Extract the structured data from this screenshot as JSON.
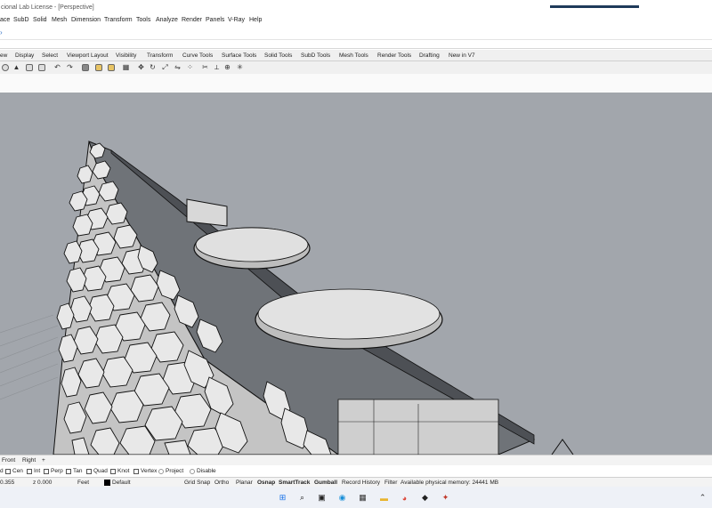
{
  "window": {
    "title": "cional Lab License - [Perspective]"
  },
  "menu": [
    "ace",
    "SubD",
    "Solid",
    "Mesh",
    "Dimension",
    "Transform",
    "Tools",
    "Analyze",
    "Render",
    "Panels",
    "V-Ray",
    "Help"
  ],
  "tabs": [
    "ew",
    "Display",
    "Select",
    "Viewport Layout",
    "Visibility",
    "Transform",
    "Curve Tools",
    "Surface Tools",
    "Solid Tools",
    "SubD Tools",
    "Mesh Tools",
    "Render Tools",
    "Drafting",
    "New in V7"
  ],
  "toolbar": {
    "icons": [
      "sphere-icon",
      "cone-icon",
      "cylinder-icon",
      "box-icon",
      "undo-icon",
      "redo-icon",
      "layer-icon",
      "open-folder-icon",
      "save-icon",
      "grid-icon",
      "move-icon",
      "rotate-icon",
      "scale-icon",
      "mirror-icon",
      "array-icon",
      "trim-icon",
      "split-icon",
      "join-icon",
      "explode-icon",
      "boolean-icon",
      "fillet-icon",
      "render-icon"
    ]
  },
  "viewport_tabs": {
    "front": "Front",
    "right": "Right",
    "add": "+"
  },
  "osnap": [
    {
      "label": "d",
      "type": "text"
    },
    {
      "label": "Cen",
      "type": "check"
    },
    {
      "label": "Int",
      "type": "check"
    },
    {
      "label": "Perp",
      "type": "check"
    },
    {
      "label": "Tan",
      "type": "check"
    },
    {
      "label": "Quad",
      "type": "check"
    },
    {
      "label": "Knot",
      "type": "check"
    },
    {
      "label": "Vertex",
      "type": "check"
    },
    {
      "label": "Project",
      "type": "radio"
    },
    {
      "label": "Disable",
      "type": "radio"
    }
  ],
  "status": {
    "y": "0.355",
    "z": "z 0.000",
    "units": "Feet",
    "layer": "Default",
    "grid_snap": "Grid Snap",
    "ortho": "Ortho",
    "planar": "Planar",
    "osnap": "Osnap",
    "smarttrack": "SmartTrack",
    "gumball": "Gumball",
    "record_history": "Record History",
    "filter": "Filter",
    "memory": "Available physical memory: 24441 MB"
  },
  "taskbar": {
    "icons": [
      "windows-start-icon",
      "search-icon",
      "task-view-icon",
      "edge-icon",
      "store-icon",
      "file-explorer-icon",
      "chrome-icon",
      "app-icon",
      "rhino-icon"
    ],
    "tray_icon": "chevron-up-icon"
  },
  "colors": {
    "viewport_bg": "#a2a6ac",
    "accent": "#1f3a5a"
  }
}
